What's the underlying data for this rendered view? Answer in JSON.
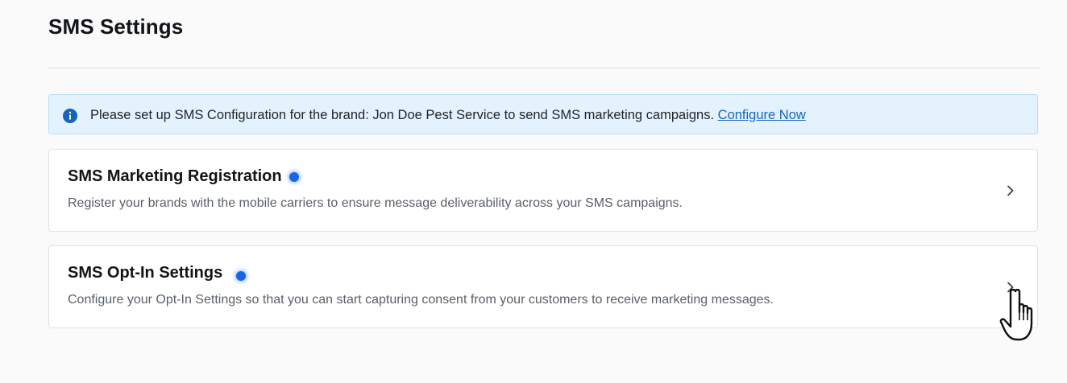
{
  "page": {
    "title": "SMS Settings"
  },
  "alert": {
    "icon": "info-icon",
    "message": "Please set up SMS Configuration for the brand: Jon Doe Pest Service to send SMS marketing campaigns.",
    "link_label": "Configure Now",
    "colors": {
      "background": "#e3f2fd",
      "icon": "#1565c0",
      "link": "#1565c0"
    }
  },
  "cards": [
    {
      "title": "SMS Marketing Registration",
      "description": "Register your brands with the mobile carriers to ensure message deliverability across your SMS campaigns.",
      "indicator": "blue-dot",
      "chevron": "chevron-right-icon"
    },
    {
      "title": "SMS Opt-In Settings",
      "description": "Configure your Opt-In Settings so that you can start capturing consent from your customers to receive marketing messages.",
      "indicator": "blue-dot",
      "chevron": "chevron-right-icon"
    }
  ],
  "cursor": {
    "icon": "hand-pointer-icon"
  },
  "colors": {
    "accent_dot": "#1a66e0",
    "page_background": "#fafafa",
    "card_background": "#ffffff"
  }
}
